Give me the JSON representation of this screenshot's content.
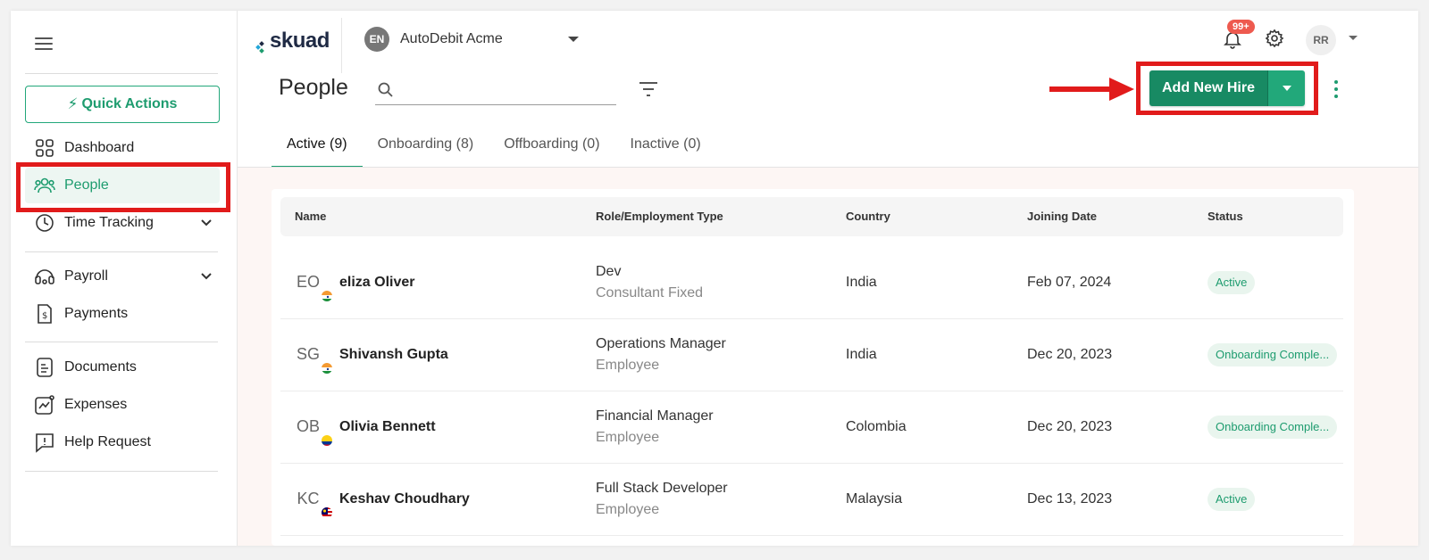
{
  "sidebar": {
    "quick_actions": "Quick Actions",
    "items": [
      {
        "label": "Dashboard",
        "icon": "grid-icon"
      },
      {
        "label": "People",
        "icon": "users-icon"
      },
      {
        "label": "Time Tracking",
        "icon": "clock-icon"
      },
      {
        "label": "Payroll",
        "icon": "payroll-icon"
      },
      {
        "label": "Payments",
        "icon": "payment-icon"
      },
      {
        "label": "Documents",
        "icon": "document-icon"
      },
      {
        "label": "Expenses",
        "icon": "expenses-icon"
      },
      {
        "label": "Help Request",
        "icon": "help-icon"
      }
    ]
  },
  "header": {
    "logo": "skuad",
    "org_initials": "EN",
    "org_name": "AutoDebit Acme",
    "notification_count": "99+",
    "user_initials": "RR"
  },
  "page": {
    "title": "People",
    "search_placeholder": "",
    "add_button": "Add New Hire"
  },
  "tabs": [
    {
      "label": "Active (9)",
      "active": true
    },
    {
      "label": "Onboarding (8)",
      "active": false
    },
    {
      "label": "Offboarding (0)",
      "active": false
    },
    {
      "label": "Inactive (0)",
      "active": false
    }
  ],
  "table": {
    "headers": [
      "Name",
      "Role/Employment Type",
      "Country",
      "Joining Date",
      "Status"
    ],
    "rows": [
      {
        "initials": "EO",
        "name": "eliza Oliver",
        "role": "Dev",
        "type": "Consultant Fixed",
        "country": "India",
        "joining": "Feb 07, 2024",
        "status": "Active"
      },
      {
        "initials": "SG",
        "name": "Shivansh Gupta",
        "role": "Operations Manager",
        "type": "Employee",
        "country": "India",
        "joining": "Dec 20, 2023",
        "status": "Onboarding Comple..."
      },
      {
        "initials": "OB",
        "name": "Olivia Bennett",
        "role": "Financial Manager",
        "type": "Employee",
        "country": "Colombia",
        "joining": "Dec 20, 2023",
        "status": "Onboarding Comple..."
      },
      {
        "initials": "KC",
        "name": "Keshav Choudhary",
        "role": "Full Stack Developer",
        "type": "Employee",
        "country": "Malaysia",
        "joining": "Dec 13, 2023",
        "status": "Active"
      }
    ]
  },
  "colors": {
    "accent": "#1e9c6f",
    "primary_button": "#188a63",
    "annotation_red": "#e11b1b",
    "badge_red": "#ee5a4f"
  }
}
